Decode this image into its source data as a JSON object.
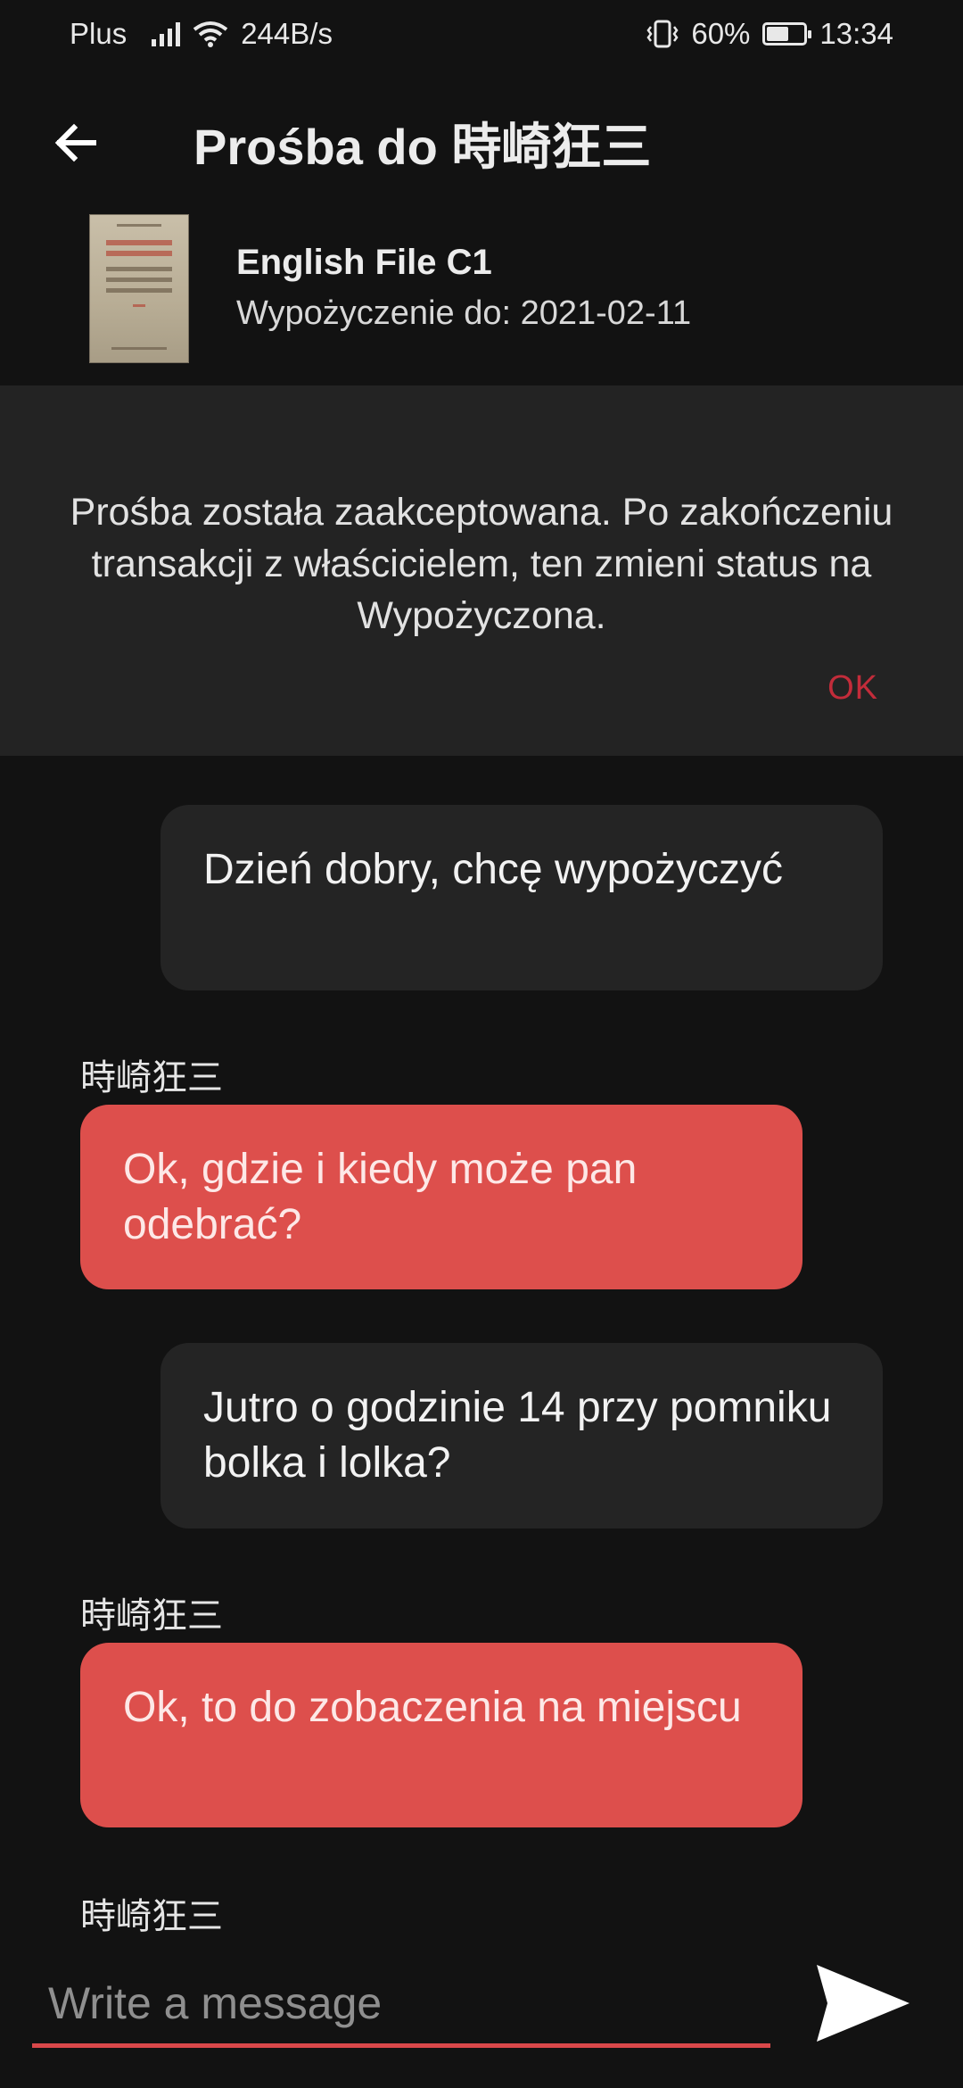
{
  "status_bar": {
    "carrier": "Plus",
    "speed": "244B/s",
    "battery": "60%",
    "battery_level": 0.6,
    "time": "13:34"
  },
  "app_bar": {
    "title": "Prośba do 時崎狂三",
    "back_icon": "arrow-left-icon"
  },
  "book": {
    "title": "English File C1",
    "due": "Wypożyczenie do: 2021-02-11"
  },
  "banner": {
    "text": "Prośba została zaakceptowana. Po zakończeniu transakcji z właścicielem, ten zmieni status na Wypożyczona.",
    "ok_label": "OK",
    "accent": "#c22c3a"
  },
  "messages": [
    {
      "from": "me",
      "text": "Dzień dobry, chcę wypożyczyć"
    },
    {
      "from": "other",
      "sender": "時崎狂三",
      "text": "Ok, gdzie i kiedy może pan odebrać?"
    },
    {
      "from": "me",
      "text": "Jutro o godzinie 14 przy pomniku bolka i lolka?"
    },
    {
      "from": "other",
      "sender": "時崎狂三",
      "text": "Ok, to do zobaczenia na miejscu"
    }
  ],
  "pending_sender": "時崎狂三",
  "composer": {
    "placeholder": "Write a message",
    "send_icon": "send-icon",
    "accent": "#d9484a"
  }
}
